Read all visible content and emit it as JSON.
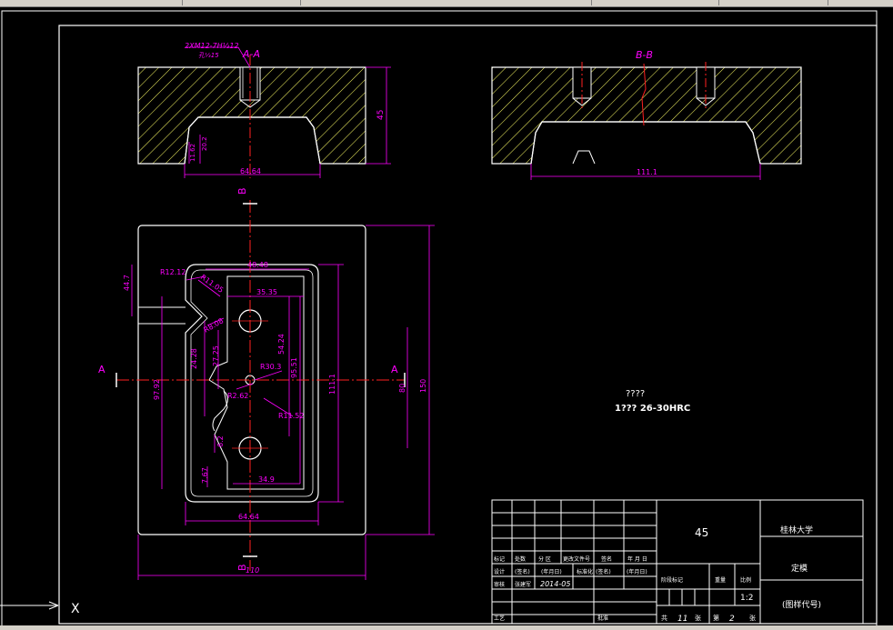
{
  "colors": {
    "background": "#000000",
    "outline": "#ffffff",
    "hatch": "#ffff66",
    "dimension": "#ff00ff",
    "centerline": "#ff2020"
  },
  "section_aa": {
    "title": "A-A",
    "thread": "2XM12-7H⅓12",
    "thread_depth": "孔⅓15",
    "dim_height": "45",
    "dim_width": "64.64",
    "dim_left1": "11.62",
    "dim_left2": "20.2"
  },
  "section_bb": {
    "title": "B-B",
    "dim_width": "111.1"
  },
  "plan": {
    "marker_a_left": "A",
    "marker_a_right": "A",
    "marker_b_top": "B",
    "marker_b_bottom": "B",
    "dims": {
      "top_width": "48.48",
      "r1": "R12.12",
      "r2": "R11.05",
      "w1": "35.35",
      "h_left": "44.7",
      "r3": "R8.08",
      "v1": "24.28",
      "v2": "27.25",
      "r4": "R30.3",
      "h1": "54.24",
      "h2": "95.51",
      "h3": "111.1",
      "h4": "80",
      "h5": "150",
      "v3": "97.92",
      "r5": "R2.62",
      "r6": "R11.52",
      "s1": "6.2",
      "s2": "7.67",
      "w2": "34.9",
      "w3": "64.64",
      "w4": "110"
    }
  },
  "notes": {
    "line1": "????",
    "line2": "1???  26-30HRC"
  },
  "title_block": {
    "material": "45",
    "school": "桂林大学",
    "part_name": "定模",
    "drawing_no": "(图样代号)",
    "scale": "1:2",
    "sheets_total": "11",
    "sheet_no": "2",
    "label_total": "共",
    "label_sheet": "张",
    "label_of": "第",
    "label_zhang": "张",
    "stage_label": "阶段标记",
    "weight_label": "重量",
    "scale_label": "比例",
    "row_mark": "标记",
    "row_count": "处数",
    "row_zone": "分  区",
    "row_change": "更改文件号",
    "row_sign": "签名",
    "row_date": "年  月  日",
    "designer": "设计",
    "sign1": "(签名)",
    "date1": "(年月日)",
    "std": "标准化",
    "sign2": "(签名)",
    "date2": "(年月日)",
    "check": "审核",
    "drafter": "张建军",
    "date3": "2014-05",
    "process": "工艺",
    "approve": "批准"
  },
  "ucs": {
    "x_label": "X"
  }
}
